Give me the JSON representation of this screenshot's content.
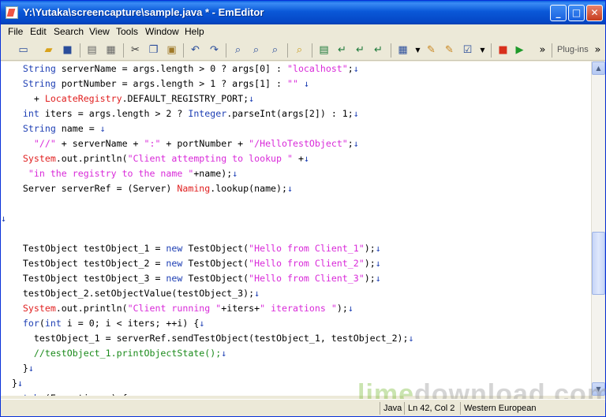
{
  "window": {
    "title": "Y:\\Yutaka\\screencapture\\sample.java * - EmEditor",
    "minimize": "_",
    "maximize": "□",
    "close": "✕"
  },
  "menu": [
    "File",
    "Edit",
    "Search",
    "View",
    "Tools",
    "Window",
    "Help"
  ],
  "toolbar": {
    "plugins_label": "Plug-ins",
    "overflow": "»"
  },
  "eol_mark": "↓",
  "code_lines": [
    [
      [
        "    ",
        ""
      ],
      [
        "String",
        "kw"
      ],
      [
        " serverName = args.length > 0 ? args[0] : ",
        ""
      ],
      [
        "\"localhost\"",
        "str"
      ],
      [
        ";",
        ""
      ]
    ],
    [
      [
        "    ",
        ""
      ],
      [
        "String",
        "kw"
      ],
      [
        " portNumber = args.length > 1 ? args[1] : ",
        ""
      ],
      [
        "\"\"",
        "str"
      ],
      [
        " ",
        ""
      ]
    ],
    [
      [
        "      + ",
        ""
      ],
      [
        "LocateRegistry",
        "cls"
      ],
      [
        ".DEFAULT_REGISTRY_PORT;",
        ""
      ]
    ],
    [
      [
        "    ",
        ""
      ],
      [
        "int",
        "kw"
      ],
      [
        " iters = args.length > 2 ? ",
        ""
      ],
      [
        "Integer",
        "kw"
      ],
      [
        ".parseInt(args[2]) : 1;",
        ""
      ]
    ],
    [
      [
        "    ",
        ""
      ],
      [
        "String",
        "kw"
      ],
      [
        " name = ",
        ""
      ]
    ],
    [
      [
        "      ",
        ""
      ],
      [
        "\"//\"",
        "str"
      ],
      [
        " + serverName + ",
        ""
      ],
      [
        "\":\"",
        "str"
      ],
      [
        " + portNumber + ",
        ""
      ],
      [
        "\"/HelloTestObject\"",
        "str"
      ],
      [
        ";",
        ""
      ]
    ],
    [
      [
        "    ",
        ""
      ],
      [
        "System",
        "cls"
      ],
      [
        ".out.println(",
        ""
      ],
      [
        "\"Client attempting to lookup \"",
        "str"
      ],
      [
        " +",
        ""
      ]
    ],
    [
      [
        "     ",
        ""
      ],
      [
        "\"in the registry to the name \"",
        "str"
      ],
      [
        "+name);",
        ""
      ]
    ],
    [
      [
        "    Server serverRef = (Server) ",
        ""
      ],
      [
        "Naming",
        "cls"
      ],
      [
        ".lookup(name);",
        ""
      ]
    ],
    [
      [
        "",
        ""
      ]
    ],
    [
      [
        "",
        ""
      ]
    ],
    [
      [
        "",
        ""
      ]
    ],
    [
      [
        "    TestObject testObject_1 = ",
        ""
      ],
      [
        "new",
        "kw"
      ],
      [
        " TestObject(",
        ""
      ],
      [
        "\"Hello from Client_1\"",
        "str"
      ],
      [
        ");",
        ""
      ]
    ],
    [
      [
        "    TestObject testObject_2 = ",
        ""
      ],
      [
        "new",
        "kw"
      ],
      [
        " TestObject(",
        ""
      ],
      [
        "\"Hello from Client_2\"",
        "str"
      ],
      [
        ");",
        ""
      ]
    ],
    [
      [
        "    TestObject testObject_3 = ",
        ""
      ],
      [
        "new",
        "kw"
      ],
      [
        " TestObject(",
        ""
      ],
      [
        "\"Hello from Client_3\"",
        "str"
      ],
      [
        ");",
        ""
      ]
    ],
    [
      [
        "    testObject_2.setObjectValue(testObject_3);",
        ""
      ]
    ],
    [
      [
        "    ",
        ""
      ],
      [
        "System",
        "cls"
      ],
      [
        ".out.println(",
        ""
      ],
      [
        "\"Client running \"",
        "str"
      ],
      [
        "+iters+",
        ""
      ],
      [
        "\" iterations \"",
        "str"
      ],
      [
        ");",
        ""
      ]
    ],
    [
      [
        "    ",
        ""
      ],
      [
        "for",
        "kw"
      ],
      [
        "(",
        ""
      ],
      [
        "int",
        "kw"
      ],
      [
        " i = 0; i < iters; ++i) {",
        ""
      ]
    ],
    [
      [
        "      testObject_1 = serverRef.sendTestObject(testObject_1, testObject_2);",
        ""
      ]
    ],
    [
      [
        "      ",
        ""
      ],
      [
        "//testObject_1.printObjectState();",
        "cmt"
      ]
    ],
    [
      [
        "    }",
        ""
      ]
    ],
    [
      [
        "  }",
        ""
      ]
    ],
    [
      [
        "  ",
        ""
      ],
      [
        "catch",
        "kw"
      ],
      [
        " (Exception e) {",
        ""
      ]
    ]
  ],
  "eol_lines": [
    0,
    1,
    2,
    3,
    4,
    5,
    6,
    7,
    8,
    10,
    12,
    13,
    14,
    15,
    16,
    17,
    18,
    19,
    20,
    21,
    22
  ],
  "status": {
    "mode": "Java",
    "position": "Ln 42, Col 2",
    "encoding": "Western European"
  },
  "watermark": {
    "part1": "lime",
    "part2": "download.com"
  }
}
